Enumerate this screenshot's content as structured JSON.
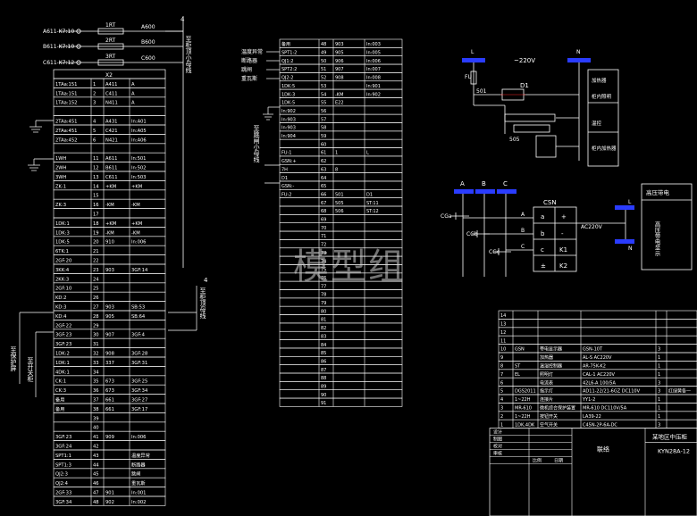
{
  "watermark": "模型组",
  "colors": {
    "line": "#ffffff",
    "accent": "#2a3cff",
    "bg": "#000000",
    "wire_red": "#ff2b2b"
  },
  "left_panel": {
    "header_inputs": [
      {
        "name": "A611-K7:10",
        "fuse": "1RT",
        "out": "A600"
      },
      {
        "name": "B611-K7:10",
        "fuse": "2RT",
        "out": "B600"
      },
      {
        "name": "C611-K7:12",
        "fuse": "3RT",
        "out": "C600"
      }
    ],
    "vertical_label_1": "至柜顶小母线",
    "table_title": "X2",
    "rows": [
      [
        "1TAa:151",
        "1",
        "A411",
        "A"
      ],
      [
        "1TAa:151",
        "2",
        "C411",
        "A"
      ],
      [
        "1TAa:152",
        "3",
        "N411",
        "A"
      ],
      [
        "",
        "",
        "",
        ""
      ],
      [
        "2TAa:451",
        "4",
        "A431",
        "In:A01"
      ],
      [
        "2TAa:451",
        "5",
        "C421",
        "In:A05"
      ],
      [
        "2TAa:452",
        "6",
        "N421",
        "In:A06"
      ],
      [
        "",
        "",
        "",
        ""
      ],
      [
        "1WH",
        "11",
        "A611",
        "In:501"
      ],
      [
        "2WH",
        "12",
        "B611",
        "In:502"
      ],
      [
        "3WH",
        "13",
        "C611",
        "In:503"
      ],
      [
        "ZK:1",
        "14",
        "+KM",
        "+KM"
      ],
      [
        "",
        "15",
        "",
        ""
      ],
      [
        "ZK:3",
        "16",
        "-KM",
        "-KM"
      ],
      [
        "",
        "17",
        "",
        ""
      ],
      [
        "1DK:1",
        "18",
        "+KM",
        "+KM"
      ],
      [
        "1DK:3",
        "19",
        "-KM",
        "-KM"
      ],
      [
        "1DK:5",
        "20",
        "910",
        "In:006"
      ],
      [
        "6TK:1",
        "21",
        "",
        ""
      ],
      [
        "2GF:20",
        "22",
        "",
        ""
      ],
      [
        "3KK:4",
        "23",
        "903",
        "3GF:14"
      ],
      [
        "2KK:3",
        "24",
        "",
        ""
      ],
      [
        "2GF:10",
        "25",
        "",
        ""
      ],
      [
        "KD:2",
        "26",
        "",
        ""
      ],
      [
        "KD:3",
        "27",
        "903",
        "SB:53"
      ],
      [
        "KD:4",
        "28",
        "905",
        "SB:64"
      ],
      [
        "2GF:22",
        "29",
        "",
        ""
      ],
      [
        "3GF:23",
        "30",
        "907",
        "3GF:4"
      ],
      [
        "3GF:23",
        "31",
        "",
        ""
      ],
      [
        "1DK:2",
        "32",
        "908",
        "3GF:28"
      ],
      [
        "1DK:1",
        "33",
        "337",
        "3GF:31"
      ],
      [
        "4DK:1",
        "34",
        "",
        ""
      ],
      [
        "CK:1",
        "35",
        "673",
        "3GF:25"
      ],
      [
        "CK:3",
        "36",
        "673",
        "3GF:34"
      ],
      [
        "备用",
        "37",
        "661",
        "3GF:27"
      ],
      [
        "备用",
        "38",
        "661",
        "3GF:17"
      ],
      [
        "",
        "39",
        "",
        ""
      ],
      [
        "",
        "40",
        "",
        ""
      ],
      [
        "3GF:23",
        "41",
        "909",
        "In:006"
      ],
      [
        "3GF:24",
        "42",
        "",
        ""
      ],
      [
        "SPT1:1",
        "43",
        "",
        "温度异常"
      ],
      [
        "SPT1:3",
        "44",
        "",
        "断路器"
      ],
      [
        "QJ2:3",
        "45",
        "",
        "跳闸"
      ],
      [
        "QJ2:4",
        "46",
        "",
        "重瓦斯"
      ],
      [
        "2GF:33",
        "47",
        "901",
        "In:001"
      ],
      [
        "3GF:34",
        "48",
        "902",
        "In:002"
      ]
    ],
    "vertical_label_2": "至保护屏",
    "vertical_label_3": "至开关柜",
    "vertical_label_4": "至柜顶母线"
  },
  "middle_panel": {
    "top_labels": [
      "温度异常",
      "断路器",
      "跳闸",
      "重瓦斯"
    ],
    "vertical_label": "至跳闸小母线",
    "rows": [
      [
        "备用",
        "48",
        "903",
        "In:003"
      ],
      [
        "SPT1:2",
        "49",
        "905",
        "In:005"
      ],
      [
        "QJ1:2",
        "50",
        "906",
        "In:006"
      ],
      [
        "SPT2:2",
        "51",
        "907",
        "In:007"
      ],
      [
        "QJ2:2",
        "52",
        "908",
        "In:008"
      ],
      [
        "1DK:5",
        "53",
        "",
        "In:901"
      ],
      [
        "1DK:3",
        "54",
        "-KM",
        "In:902"
      ],
      [
        "1DK:5",
        "55",
        "E22",
        ""
      ],
      [
        "In:902",
        "56",
        "",
        ""
      ],
      [
        "In:903",
        "57",
        "",
        ""
      ],
      [
        "In:903",
        "58",
        "",
        ""
      ],
      [
        "In:904",
        "59",
        "",
        ""
      ],
      [
        "",
        "60",
        "",
        ""
      ],
      [
        "FU:1",
        "61",
        "1",
        "L"
      ],
      [
        "GSN:+",
        "62",
        "",
        ""
      ],
      [
        "7H",
        "63",
        "8",
        ""
      ],
      [
        "D1",
        "64",
        "",
        ""
      ],
      [
        "GSN:-",
        "65",
        "",
        ""
      ],
      [
        "FU:2",
        "66",
        "501",
        "D1"
      ],
      [
        "",
        "67",
        "505",
        "ST:11"
      ],
      [
        "",
        "68",
        "506",
        "ST:12"
      ],
      [
        "",
        "69",
        "",
        ""
      ],
      [
        "",
        "70",
        "",
        ""
      ],
      [
        "",
        "71",
        "",
        ""
      ],
      [
        "",
        "72",
        "",
        ""
      ],
      [
        "",
        "73",
        "",
        ""
      ],
      [
        "",
        "74",
        "",
        ""
      ],
      [
        "",
        "75",
        "",
        ""
      ],
      [
        "",
        "76",
        "",
        ""
      ],
      [
        "",
        "77",
        "",
        ""
      ],
      [
        "",
        "78",
        "",
        ""
      ],
      [
        "",
        "79",
        "",
        ""
      ],
      [
        "",
        "80",
        "",
        ""
      ],
      [
        "",
        "81",
        "",
        ""
      ],
      [
        "",
        "82",
        "",
        ""
      ],
      [
        "",
        "83",
        "",
        ""
      ],
      [
        "",
        "84",
        "",
        ""
      ],
      [
        "",
        "85",
        "",
        ""
      ],
      [
        "",
        "86",
        "",
        ""
      ],
      [
        "",
        "87",
        "",
        ""
      ],
      [
        "",
        "88",
        "",
        ""
      ],
      [
        "",
        "89",
        "",
        ""
      ],
      [
        "",
        "90",
        "",
        ""
      ],
      [
        "",
        "91",
        "",
        ""
      ]
    ]
  },
  "heater_circuit": {
    "L": "L",
    "N": "N",
    "voltage": "~220V",
    "fuse": "FU",
    "node": "501",
    "diode": "D1",
    "terminal": "505",
    "right_box": [
      "加热器",
      "柜内照明",
      "温控",
      "柜内加热器"
    ]
  },
  "sensor_circuit": {
    "phases": [
      "A",
      "B",
      "C"
    ],
    "module": "CSN",
    "caps": [
      "CGa",
      "CGb",
      "CGc"
    ],
    "terminals": [
      "a",
      "b",
      "c",
      "±"
    ],
    "outputs": [
      "+",
      "-",
      "K1",
      "K2"
    ],
    "voltage": "AC220V",
    "L": "L",
    "N": "N",
    "box_title": "高压带电",
    "box_text": "高压带电显示"
  },
  "bom_table": {
    "rows": [
      [
        "14",
        "",
        "",
        "",
        "",
        ""
      ],
      [
        "13",
        "",
        "",
        "",
        "",
        ""
      ],
      [
        "12",
        "",
        "",
        "",
        "",
        ""
      ],
      [
        "11",
        "",
        "",
        "",
        "",
        ""
      ],
      [
        "10",
        "GSN",
        "带电显示器",
        "GSN-10T",
        "3",
        ""
      ],
      [
        "9",
        "",
        "加热器",
        "AL-S AC220V",
        "1",
        ""
      ],
      [
        "8",
        "ST",
        "温湿控制器",
        "AR-75K-K2",
        "1",
        ""
      ],
      [
        "7",
        "EL",
        "照明灯",
        "CAL-1 AC220V",
        "1",
        ""
      ],
      [
        "6",
        "",
        "电流表",
        "42L6-A 100/5A",
        "3",
        ""
      ],
      [
        "5",
        "DGS2011",
        "指示灯",
        "AD11-22/21-6GZ DC110V",
        "3",
        "红绿黄各一"
      ],
      [
        "4",
        "1~22H",
        "连接片",
        "YY1-2",
        "1",
        ""
      ],
      [
        "3",
        "MR-610",
        "微机综合保护装置",
        "MR-610 DC110V/5A",
        "1",
        ""
      ],
      [
        "2",
        "1~22H",
        "按钮开关",
        "LA39-22",
        "1",
        ""
      ],
      [
        "1",
        "1DK,4DK",
        "空气开关",
        "C45N-2P-6A-DC",
        "3",
        ""
      ]
    ],
    "title_labels": {
      "design": "设计",
      "draw": "制图",
      "check": "校对",
      "approve": "审核"
    },
    "drawing_name": "联络",
    "company": "某地区中压柜",
    "drawing_no": "KYN28A-12",
    "sheet_label": "比例",
    "date_label": "日期"
  }
}
